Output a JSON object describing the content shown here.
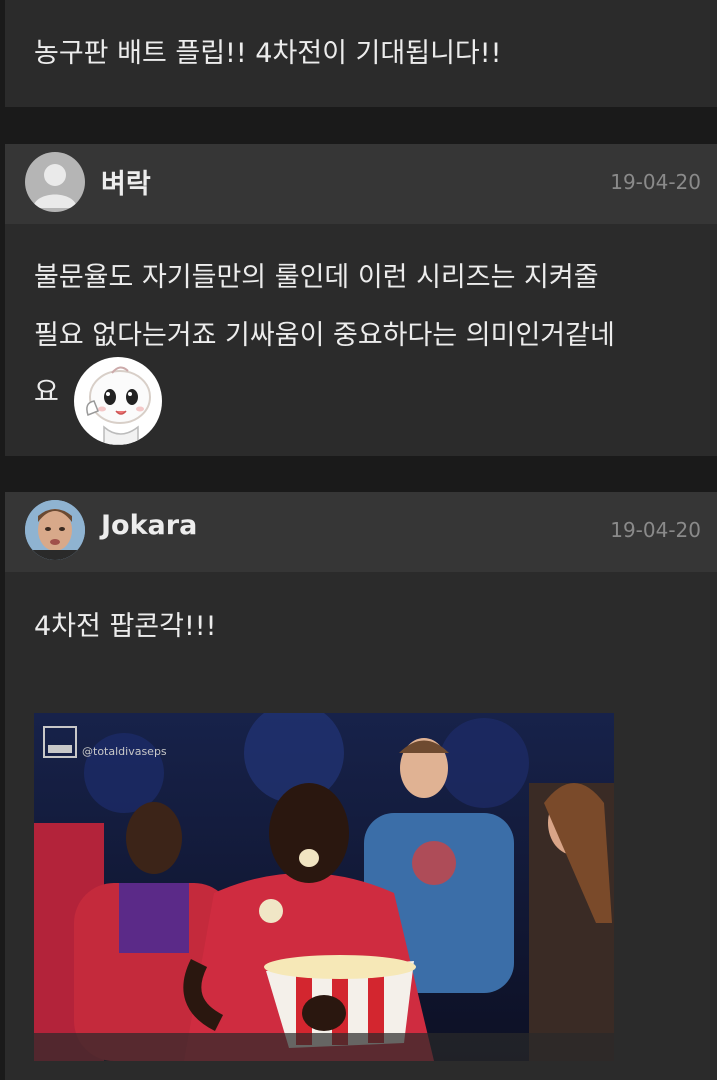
{
  "comments": [
    {
      "text": "농구판 배트 플립!! 4차전이 기대됩니다!!"
    },
    {
      "author": "벼락",
      "date": "19-04-20",
      "avatar_icon": "default-user-icon",
      "lines": [
        "불문율도 자기들만의 룰인데 이런 시리즈는 지켜줄",
        "필요 없다는거죠 기싸움이 중요하다는 의미인거같네",
        "요"
      ],
      "emoticon": "cartoon-face-emoticon"
    },
    {
      "author": "Jokara",
      "date": "19-04-20",
      "avatar_icon": "profile-photo-avatar",
      "text": "4차전 팝콘각!!!",
      "gif_watermark": "@totaldivaseps",
      "gif_description": "popcorn-eating-gif"
    }
  ]
}
